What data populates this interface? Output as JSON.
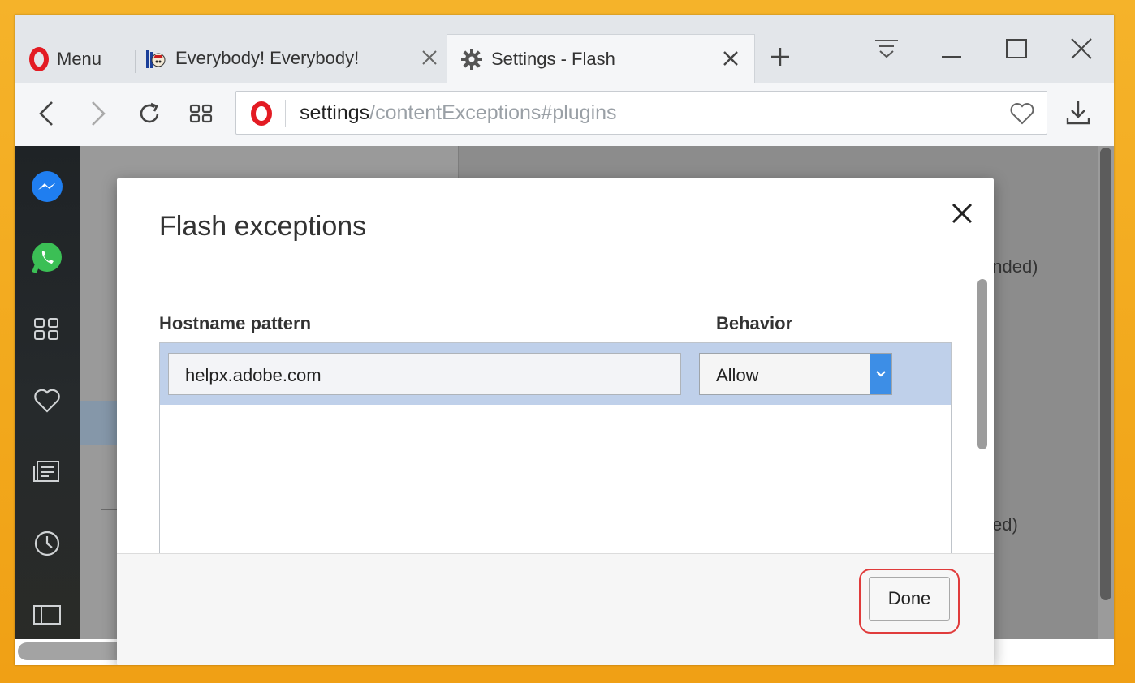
{
  "tabbar": {
    "menu_label": "Menu",
    "tabs": [
      {
        "title": "Everybody! Everybody!",
        "favicon": "homestar-favicon-icon",
        "active": false
      },
      {
        "title": "Settings - Flash",
        "favicon": "gear-icon",
        "active": true
      }
    ],
    "window_controls": [
      "tab-menu-icon",
      "minimize-icon",
      "maximize-icon",
      "close-icon"
    ]
  },
  "toolbar": {
    "address_host": "settings",
    "address_path": "/contentExceptions#plugins"
  },
  "sidebar": {
    "items": [
      "messenger-icon",
      "whatsapp-icon",
      "speed-dial-icon",
      "bookmarks-heart-icon",
      "news-icon",
      "history-clock-icon",
      "sidebar-toggle-icon"
    ]
  },
  "background": {
    "text1": "ended)",
    "text2": "ed)"
  },
  "dialog": {
    "title": "Flash exceptions",
    "col_hostname": "Hostname pattern",
    "col_behavior": "Behavior",
    "rows": [
      {
        "hostname": "helpx.adobe.com",
        "behavior": "Allow"
      }
    ],
    "done_label": "Done"
  },
  "colors": {
    "accent": "#3d8ee6",
    "row_selected": "#bfd0ea",
    "highlight_ring": "#e03b3b",
    "opera_red": "#e31b23"
  }
}
